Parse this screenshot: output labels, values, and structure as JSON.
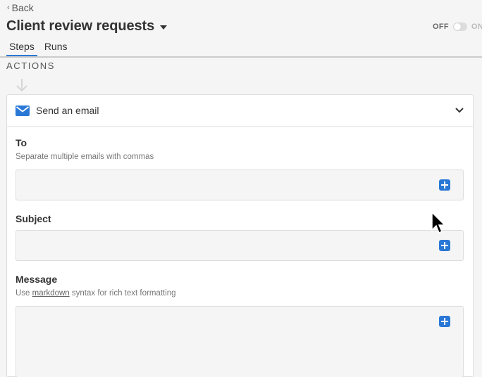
{
  "nav": {
    "back_label": "Back"
  },
  "header": {
    "title": "Client review requests",
    "toggle": {
      "off_label": "OFF",
      "on_label": "ON",
      "state": "off"
    }
  },
  "tabs": [
    {
      "label": "Steps",
      "active": true
    },
    {
      "label": "Runs",
      "active": false
    }
  ],
  "section": {
    "label": "ACTIONS"
  },
  "action_card": {
    "title": "Send an email",
    "icon": "envelope-icon",
    "fields": {
      "to": {
        "label": "To",
        "hint": "Separate multiple emails with commas",
        "value": ""
      },
      "subject": {
        "label": "Subject",
        "value": ""
      },
      "message": {
        "label": "Message",
        "hint_prefix": "Use ",
        "hint_link": "markdown",
        "hint_suffix": " syntax for rich text formatting",
        "value": ""
      }
    }
  },
  "colors": {
    "accent": "#2a78d6",
    "background": "#f5f5f5",
    "border": "#dddddd"
  }
}
